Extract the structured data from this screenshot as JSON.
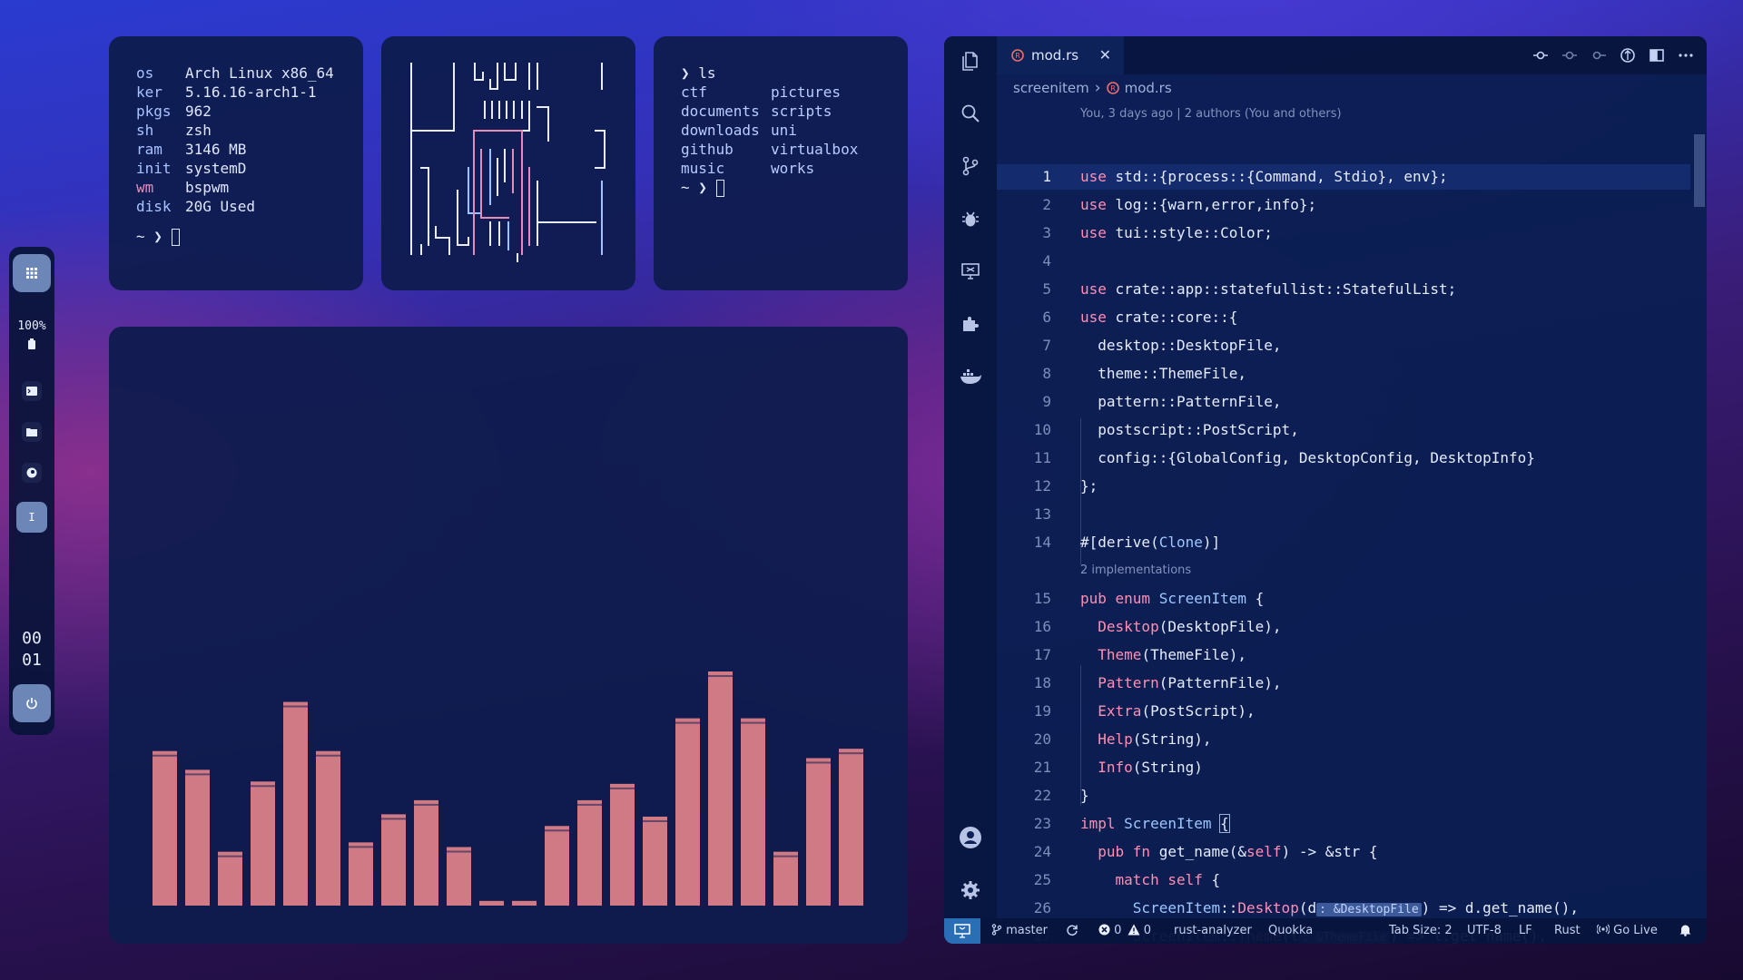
{
  "sysinfo": {
    "rows": [
      {
        "key": "os",
        "value": "Arch Linux x86_64"
      },
      {
        "key": "ker",
        "value": "5.16.16-arch1-1"
      },
      {
        "key": "pkgs",
        "value": "962"
      },
      {
        "key": "sh",
        "value": "zsh"
      },
      {
        "key": "ram",
        "value": "3146 MB"
      },
      {
        "key": "init",
        "value": "systemD"
      },
      {
        "key": "wm",
        "value": "bspwm"
      },
      {
        "key": "disk",
        "value": "20G Used"
      }
    ],
    "prompt": "~ ❯"
  },
  "ls": {
    "command": "❯ ls",
    "entries": [
      "ctf",
      "pictures",
      "documents",
      "scripts",
      "downloads",
      "uni",
      "github",
      "virtualbox",
      "music",
      "works"
    ],
    "prompt": "~ ❯"
  },
  "dock": {
    "battery": "100%",
    "clock_hours": "00",
    "clock_minutes": "01"
  },
  "visualizer": {
    "levels": [
      0.66,
      0.58,
      0.23,
      0.53,
      0.87,
      0.66,
      0.27,
      0.39,
      0.45,
      0.25,
      0.02,
      0.02,
      0.34,
      0.45,
      0.52,
      0.38,
      0.8,
      1.0,
      0.8,
      0.23,
      0.63,
      0.67
    ],
    "bar_color": "#cf7a85"
  },
  "editor": {
    "tab": {
      "filename": "mod.rs",
      "close": "✕"
    },
    "breadcrumb": {
      "folder": "screenitem",
      "separator": "›",
      "file": "mod.rs"
    },
    "blame": "You, 3 days ago | 2 authors (You and others)",
    "impl_lens": "2 implementations",
    "status": {
      "branch": "master",
      "errors": "0",
      "warnings": "0",
      "analyzer": "rust-analyzer",
      "quokka": "Quokka",
      "tabsize": "Tab Size: 2",
      "encoding": "UTF-8",
      "eol": "LF",
      "language": "Rust",
      "golive": "Go Live"
    }
  },
  "colors": {
    "accent": "#2a6fb5",
    "keyword": "#ff8fb4",
    "type": "#9ec7ff",
    "bar": "#cf7a85"
  }
}
